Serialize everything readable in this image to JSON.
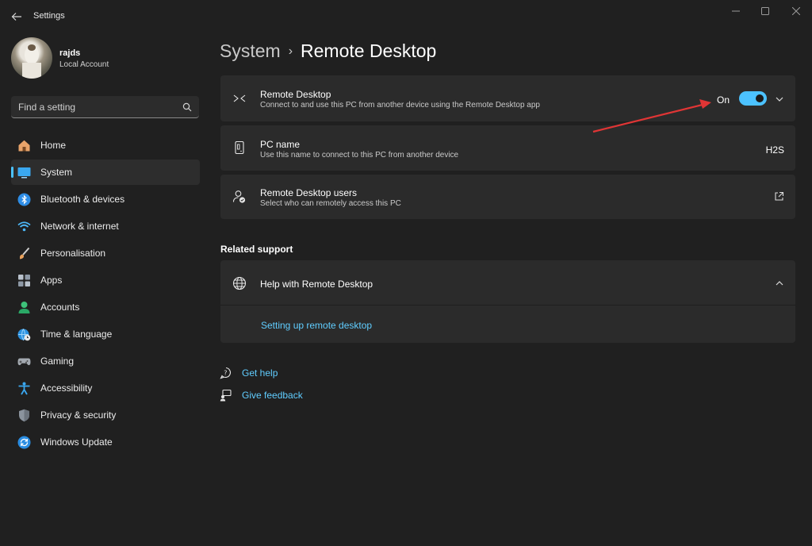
{
  "window": {
    "title": "Settings"
  },
  "profile": {
    "name": "rajds",
    "account_type": "Local Account"
  },
  "search": {
    "placeholder": "Find a setting"
  },
  "sidebar": {
    "items": [
      {
        "label": "Home",
        "icon": "home-icon",
        "active": false
      },
      {
        "label": "System",
        "icon": "monitor-icon",
        "active": true
      },
      {
        "label": "Bluetooth & devices",
        "icon": "bluetooth-icon",
        "active": false
      },
      {
        "label": "Network & internet",
        "icon": "wifi-icon",
        "active": false
      },
      {
        "label": "Personalisation",
        "icon": "paintbrush-icon",
        "active": false
      },
      {
        "label": "Apps",
        "icon": "apps-icon",
        "active": false
      },
      {
        "label": "Accounts",
        "icon": "person-icon",
        "active": false
      },
      {
        "label": "Time & language",
        "icon": "globe-clock-icon",
        "active": false
      },
      {
        "label": "Gaming",
        "icon": "gamepad-icon",
        "active": false
      },
      {
        "label": "Accessibility",
        "icon": "accessibility-icon",
        "active": false
      },
      {
        "label": "Privacy & security",
        "icon": "shield-icon",
        "active": false
      },
      {
        "label": "Windows Update",
        "icon": "update-icon",
        "active": false
      }
    ]
  },
  "breadcrumb": {
    "parent": "System",
    "separator": "›",
    "current": "Remote Desktop"
  },
  "remote_desktop": {
    "title": "Remote Desktop",
    "subtitle": "Connect to and use this PC from another device using the Remote Desktop app",
    "toggle_label": "On",
    "enabled": true
  },
  "pc_name": {
    "title": "PC name",
    "subtitle": "Use this name to connect to this PC from another device",
    "value": "H2S"
  },
  "rd_users": {
    "title": "Remote Desktop users",
    "subtitle": "Select who can remotely access this PC"
  },
  "related_support": {
    "heading": "Related support",
    "help_title": "Help with Remote Desktop",
    "link": "Setting up remote desktop"
  },
  "footer": {
    "get_help": "Get help",
    "give_feedback": "Give feedback"
  },
  "colors": {
    "accent": "#4cc2ff",
    "link": "#60cdff",
    "annotation_arrow": "#e03535"
  }
}
